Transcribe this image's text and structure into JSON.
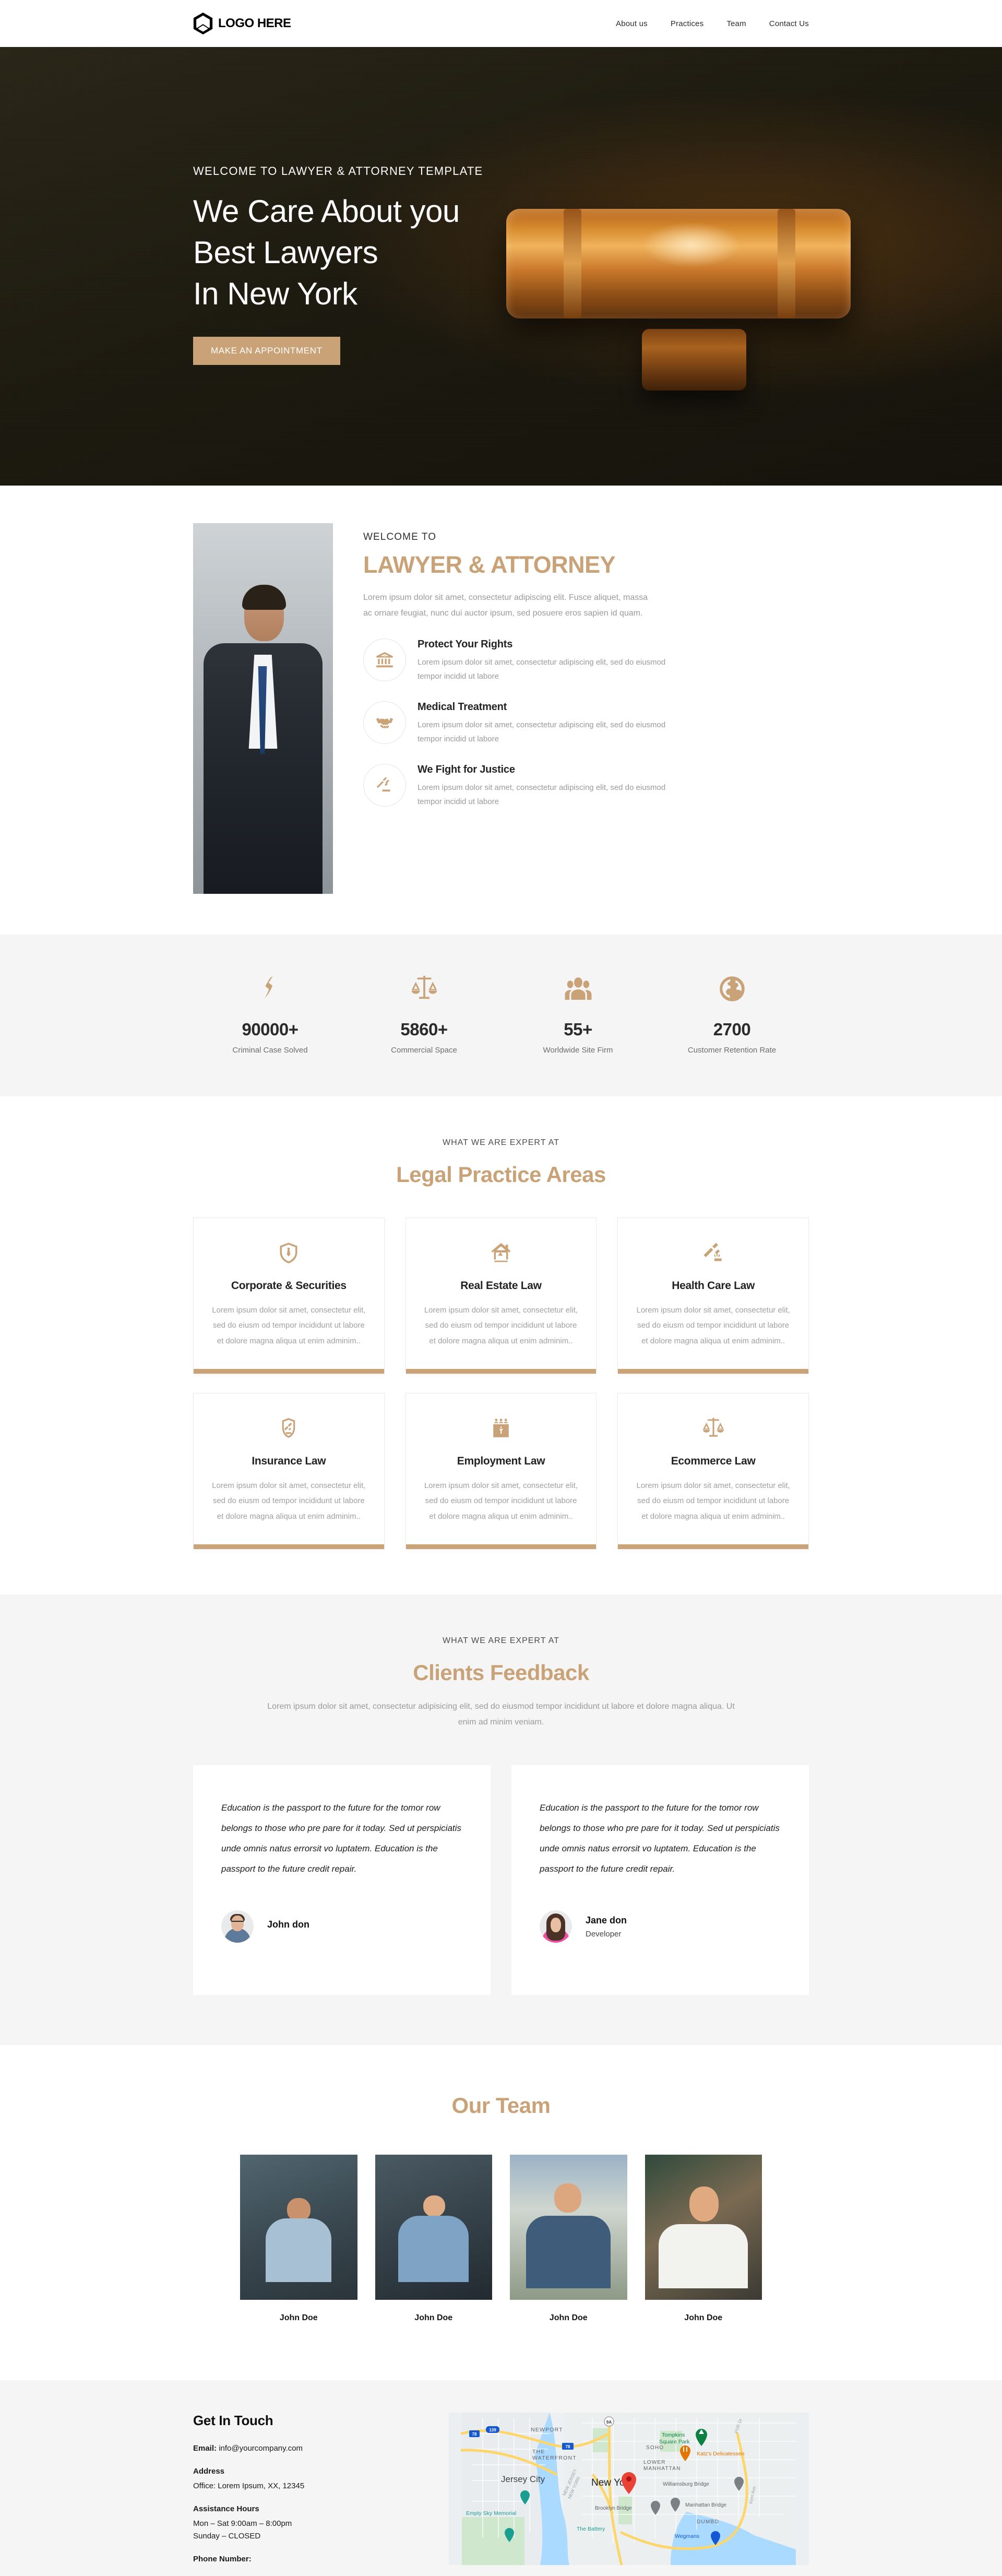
{
  "header": {
    "logo_text": "LOGO HERE",
    "nav": [
      {
        "label": "About us"
      },
      {
        "label": "Practices"
      },
      {
        "label": "Team"
      },
      {
        "label": "Contact Us"
      }
    ]
  },
  "hero": {
    "kicker": "WELCOME TO LAWYER & ATTORNEY TEMPLATE",
    "line1": "We Care About you",
    "line2": "Best Lawyers",
    "line3": "In New York",
    "button": "MAKE AN APPOINTMENT",
    "accent_color": "#c9a377"
  },
  "about": {
    "kicker": "WELCOME TO",
    "title": "LAWYER & ATTORNEY",
    "paragraph": "Lorem ipsum dolor sit amet, consectetur adipiscing elit. Fusce aliquet, massa ac ornare feugiat, nunc dui auctor ipsum, sed posuere eros sapien id quam.",
    "features": [
      {
        "icon": "courthouse-icon",
        "title": "Protect Your Rights",
        "text": "Lorem ipsum dolor sit amet, consectetur adipiscing elit, sed do eiusmod tempor incidid ut labore"
      },
      {
        "icon": "handshake-icon",
        "title": "Medical Treatment",
        "text": "Lorem ipsum dolor sit amet, consectetur adipiscing elit, sed do eiusmod tempor incidid ut labore"
      },
      {
        "icon": "gavel-icon",
        "title": "We Fight for Justice",
        "text": "Lorem ipsum dolor sit amet, consectetur adipiscing elit, sed do eiusmod tempor incidid ut labore"
      }
    ]
  },
  "stats": [
    {
      "icon": "gavel-icon",
      "value": "90000+",
      "label": "Criminal Case Solved"
    },
    {
      "icon": "scales-icon",
      "value": "5860+",
      "label": "Commercial Space"
    },
    {
      "icon": "people-icon",
      "value": "55+",
      "label": "Worldwide Site Firm"
    },
    {
      "icon": "globe-icon",
      "value": "2700",
      "label": "Customer Retention Rate"
    }
  ],
  "practice": {
    "kicker": "WHAT WE ARE EXPERT AT",
    "title": "Legal Practice Areas",
    "cards": [
      {
        "icon": "shield-tie-icon",
        "title": "Corporate & Securities",
        "text": "Lorem ipsum dolor sit amet, consectetur elit, sed do eiusm od tempor incididunt ut labore et dolore magna aliqua ut enim adminim.."
      },
      {
        "icon": "house-scales-icon",
        "title": "Real Estate Law",
        "text": "Lorem ipsum dolor sit amet, consectetur elit, sed do eiusm od tempor incididunt ut labore et dolore magna aliqua ut enim adminim.."
      },
      {
        "icon": "gavel-strike-icon",
        "title": "Health Care Law",
        "text": "Lorem ipsum dolor sit amet, consectetur elit, sed do eiusm od tempor incididunt ut labore et dolore magna aliqua ut enim adminim.."
      },
      {
        "icon": "shield-gavel-icon",
        "title": "Insurance Law",
        "text": "Lorem ipsum dolor sit amet, consectetur elit, sed do eiusm od tempor incididunt ut labore et dolore magna aliqua ut enim adminim.."
      },
      {
        "icon": "jury-podium-icon",
        "title": "Employment Law",
        "text": "Lorem ipsum dolor sit amet, consectetur elit, sed do eiusm od tempor incididunt ut labore et dolore magna aliqua ut enim adminim.."
      },
      {
        "icon": "scales-icon",
        "title": "Ecommerce Law",
        "text": "Lorem ipsum dolor sit amet, consectetur elit, sed do eiusm od tempor incididunt ut labore et dolore magna aliqua ut enim adminim.."
      }
    ]
  },
  "feedback": {
    "kicker": "WHAT WE ARE EXPERT AT",
    "title": "Clients Feedback",
    "subtitle": "Lorem ipsum dolor sit amet, consectetur adipisicing elit, sed do eiusmod tempor incididunt ut labore et dolore magna aliqua. Ut enim ad minim veniam.",
    "items": [
      {
        "quote": "Education is the passport to the future for the tomor row belongs to those who pre pare for it today. Sed ut perspiciatis unde omnis natus errorsit vo luptatem. Education is the passport to the future credit repair.",
        "name": "John don",
        "role": ""
      },
      {
        "quote": "Education is the passport to the future for the tomor row belongs to those who pre pare for it today. Sed ut perspiciatis unde omnis natus errorsit vo luptatem. Education is the passport to the future credit repair.",
        "name": "Jane don",
        "role": "Developer"
      }
    ]
  },
  "team": {
    "title": "Our Team",
    "members": [
      {
        "name": "John Doe"
      },
      {
        "name": "John Doe"
      },
      {
        "name": "John Doe"
      },
      {
        "name": "John Doe"
      }
    ]
  },
  "contact": {
    "title": "Get In Touch",
    "email_label": "Email:",
    "email_value": "info@yourcompany.com",
    "address_label": "Address",
    "address_value": "Office: Lorem Ipsum, XX, 12345",
    "hours_label": "Assistance Hours",
    "hours_line1": "Mon – Sat 9:00am – 8:00pm",
    "hours_line2": "Sunday – CLOSED",
    "phone_label": "Phone Number:",
    "map": {
      "center_label": "New York",
      "labels": [
        "NEWPORT",
        "THE WATERFRONT",
        "Jersey City",
        "Empty Sky Memorial",
        "SOHO",
        "LOWER MANHATTAN",
        "Tompkins Square Park",
        "Katz's Delicatessen",
        "Williamsburg Bridge",
        "Manhattan Bridge",
        "Brooklyn Bridge",
        "DUMBO",
        "The Battery",
        "Wegmans",
        "NEW JERSEY",
        "NEW YORK",
        "FDR Dr",
        "Kent Ave"
      ],
      "route_shields": [
        "78",
        "139",
        "9A"
      ]
    }
  }
}
